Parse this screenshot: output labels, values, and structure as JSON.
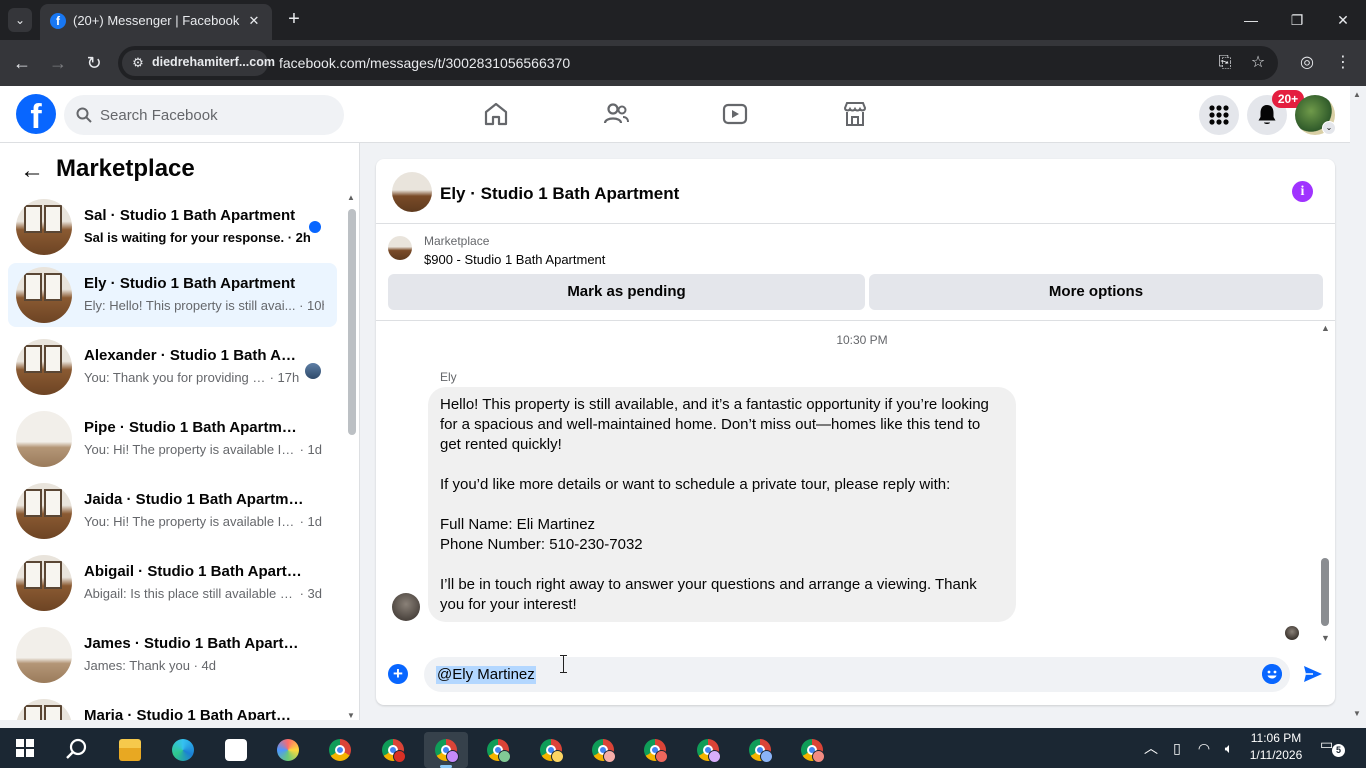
{
  "browser": {
    "tab_title": "(20+) Messenger | Facebook",
    "site_chip": "diedrehamiterf...com",
    "url": "facebook.com/messages/t/3002831056566370",
    "tab_favicon": "f"
  },
  "fb": {
    "logo": "f",
    "search_placeholder": "Search Facebook",
    "notif_badge": "20+"
  },
  "sidebar": {
    "title": "Marketplace",
    "conversations": [
      {
        "name": "Sal · Studio 1 Bath Apartment",
        "preview": "Sal is waiting for your response.",
        "time": " · 2h",
        "unread": true
      },
      {
        "name": "Ely · Studio 1 Bath Apartment",
        "preview": "Ely: Hello! This property is still avai...",
        "time": " · 10h",
        "active": true
      },
      {
        "name": "Alexander · Studio 1 Bath Apa...",
        "preview": "You: Thank you for providing y...",
        "time": " · 17h"
      },
      {
        "name": "Pipe · Studio 1 Bath Apartment",
        "preview": "You: Hi! The property is available If ...",
        "time": " · 1d"
      },
      {
        "name": "Jaida · Studio 1 Bath Apartment",
        "preview": "You: Hi! The property is available If ...",
        "time": " · 1d"
      },
      {
        "name": "Abigail · Studio 1 Bath Apartment",
        "preview": "Abigail: Is this place still available b...",
        "time": " · 3d"
      },
      {
        "name": "James · Studio 1 Bath Apartment",
        "preview": "James: Thank you",
        "time": " · 4d"
      },
      {
        "name": "Maria · Studio 1 Bath Apartment",
        "preview": "",
        "time": ""
      }
    ]
  },
  "chat": {
    "title": "Ely · Studio 1 Bath Apartment",
    "info_glyph": "i",
    "marketplace_label": "Marketplace",
    "listing": "$900 - Studio 1 Bath Apartment",
    "mark_pending": "Mark as pending",
    "more_options": "More options",
    "timestamp": "10:30 PM",
    "sender": "Ely",
    "message": "Hello! This property is still available, and it’s a fantastic opportunity if you’re looking for a spacious and well-maintained home. Don’t miss out—homes like this tend to get rented quickly!\n\nIf you’d like more details or want to schedule a private tour, please reply with:\n\nFull Name: Eli Martinez\nPhone Number: 510-230-7032\n\nI’ll be in touch right away to answer your questions and arrange a viewing. Thank you for your interest!",
    "composer_value": "@Ely Martinez"
  },
  "taskbar": {
    "time": "11:06 PM",
    "date": "1/11/2026",
    "notifications": "5"
  }
}
